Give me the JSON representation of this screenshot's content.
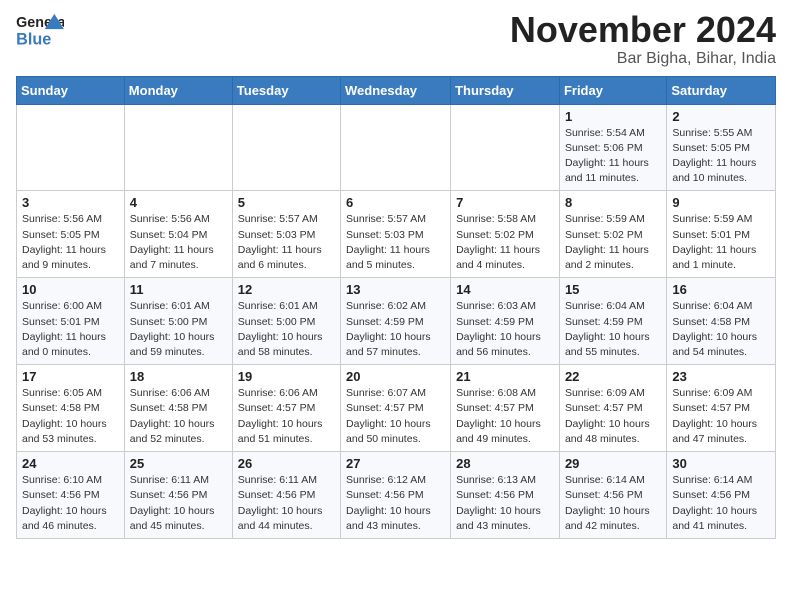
{
  "header": {
    "logo_general": "General",
    "logo_blue": "Blue",
    "month_title": "November 2024",
    "location": "Bar Bigha, Bihar, India"
  },
  "calendar": {
    "headers": [
      "Sunday",
      "Monday",
      "Tuesday",
      "Wednesday",
      "Thursday",
      "Friday",
      "Saturday"
    ],
    "weeks": [
      {
        "days": [
          {
            "num": "",
            "info": ""
          },
          {
            "num": "",
            "info": ""
          },
          {
            "num": "",
            "info": ""
          },
          {
            "num": "",
            "info": ""
          },
          {
            "num": "",
            "info": ""
          },
          {
            "num": "1",
            "info": "Sunrise: 5:54 AM\nSunset: 5:06 PM\nDaylight: 11 hours and 11 minutes."
          },
          {
            "num": "2",
            "info": "Sunrise: 5:55 AM\nSunset: 5:05 PM\nDaylight: 11 hours and 10 minutes."
          }
        ]
      },
      {
        "days": [
          {
            "num": "3",
            "info": "Sunrise: 5:56 AM\nSunset: 5:05 PM\nDaylight: 11 hours and 9 minutes."
          },
          {
            "num": "4",
            "info": "Sunrise: 5:56 AM\nSunset: 5:04 PM\nDaylight: 11 hours and 7 minutes."
          },
          {
            "num": "5",
            "info": "Sunrise: 5:57 AM\nSunset: 5:03 PM\nDaylight: 11 hours and 6 minutes."
          },
          {
            "num": "6",
            "info": "Sunrise: 5:57 AM\nSunset: 5:03 PM\nDaylight: 11 hours and 5 minutes."
          },
          {
            "num": "7",
            "info": "Sunrise: 5:58 AM\nSunset: 5:02 PM\nDaylight: 11 hours and 4 minutes."
          },
          {
            "num": "8",
            "info": "Sunrise: 5:59 AM\nSunset: 5:02 PM\nDaylight: 11 hours and 2 minutes."
          },
          {
            "num": "9",
            "info": "Sunrise: 5:59 AM\nSunset: 5:01 PM\nDaylight: 11 hours and 1 minute."
          }
        ]
      },
      {
        "days": [
          {
            "num": "10",
            "info": "Sunrise: 6:00 AM\nSunset: 5:01 PM\nDaylight: 11 hours and 0 minutes."
          },
          {
            "num": "11",
            "info": "Sunrise: 6:01 AM\nSunset: 5:00 PM\nDaylight: 10 hours and 59 minutes."
          },
          {
            "num": "12",
            "info": "Sunrise: 6:01 AM\nSunset: 5:00 PM\nDaylight: 10 hours and 58 minutes."
          },
          {
            "num": "13",
            "info": "Sunrise: 6:02 AM\nSunset: 4:59 PM\nDaylight: 10 hours and 57 minutes."
          },
          {
            "num": "14",
            "info": "Sunrise: 6:03 AM\nSunset: 4:59 PM\nDaylight: 10 hours and 56 minutes."
          },
          {
            "num": "15",
            "info": "Sunrise: 6:04 AM\nSunset: 4:59 PM\nDaylight: 10 hours and 55 minutes."
          },
          {
            "num": "16",
            "info": "Sunrise: 6:04 AM\nSunset: 4:58 PM\nDaylight: 10 hours and 54 minutes."
          }
        ]
      },
      {
        "days": [
          {
            "num": "17",
            "info": "Sunrise: 6:05 AM\nSunset: 4:58 PM\nDaylight: 10 hours and 53 minutes."
          },
          {
            "num": "18",
            "info": "Sunrise: 6:06 AM\nSunset: 4:58 PM\nDaylight: 10 hours and 52 minutes."
          },
          {
            "num": "19",
            "info": "Sunrise: 6:06 AM\nSunset: 4:57 PM\nDaylight: 10 hours and 51 minutes."
          },
          {
            "num": "20",
            "info": "Sunrise: 6:07 AM\nSunset: 4:57 PM\nDaylight: 10 hours and 50 minutes."
          },
          {
            "num": "21",
            "info": "Sunrise: 6:08 AM\nSunset: 4:57 PM\nDaylight: 10 hours and 49 minutes."
          },
          {
            "num": "22",
            "info": "Sunrise: 6:09 AM\nSunset: 4:57 PM\nDaylight: 10 hours and 48 minutes."
          },
          {
            "num": "23",
            "info": "Sunrise: 6:09 AM\nSunset: 4:57 PM\nDaylight: 10 hours and 47 minutes."
          }
        ]
      },
      {
        "days": [
          {
            "num": "24",
            "info": "Sunrise: 6:10 AM\nSunset: 4:56 PM\nDaylight: 10 hours and 46 minutes."
          },
          {
            "num": "25",
            "info": "Sunrise: 6:11 AM\nSunset: 4:56 PM\nDaylight: 10 hours and 45 minutes."
          },
          {
            "num": "26",
            "info": "Sunrise: 6:11 AM\nSunset: 4:56 PM\nDaylight: 10 hours and 44 minutes."
          },
          {
            "num": "27",
            "info": "Sunrise: 6:12 AM\nSunset: 4:56 PM\nDaylight: 10 hours and 43 minutes."
          },
          {
            "num": "28",
            "info": "Sunrise: 6:13 AM\nSunset: 4:56 PM\nDaylight: 10 hours and 43 minutes."
          },
          {
            "num": "29",
            "info": "Sunrise: 6:14 AM\nSunset: 4:56 PM\nDaylight: 10 hours and 42 minutes."
          },
          {
            "num": "30",
            "info": "Sunrise: 6:14 AM\nSunset: 4:56 PM\nDaylight: 10 hours and 41 minutes."
          }
        ]
      }
    ]
  }
}
